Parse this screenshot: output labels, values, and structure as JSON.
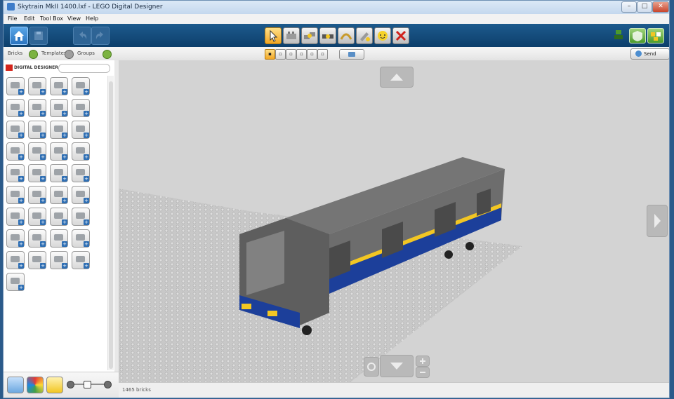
{
  "window": {
    "title": "Skytrain MkII 1400.lxf - LEGO Digital Designer"
  },
  "menu": [
    "File",
    "Edit",
    "Tool Box",
    "View",
    "Help"
  ],
  "tabs": {
    "bricks": "Bricks",
    "templates": "Templates",
    "groups": "Groups"
  },
  "send": {
    "label": "Send"
  },
  "brand": {
    "text": "DIGITAL DESIGNER"
  },
  "status": {
    "brick_count": "1465 bricks"
  },
  "accent_colors": {
    "toolbar": "#0d3f6c",
    "active_tool": "#f2a623",
    "lego_red": "#d4261d"
  },
  "icons": {
    "tools": [
      "select-arrow-icon",
      "clone-icon",
      "hinge-icon",
      "hinge-align-icon",
      "flex-icon",
      "paint-icon",
      "hide-icon",
      "delete-icon"
    ],
    "modes": [
      "build-mode-icon",
      "view-mode-icon"
    ]
  }
}
